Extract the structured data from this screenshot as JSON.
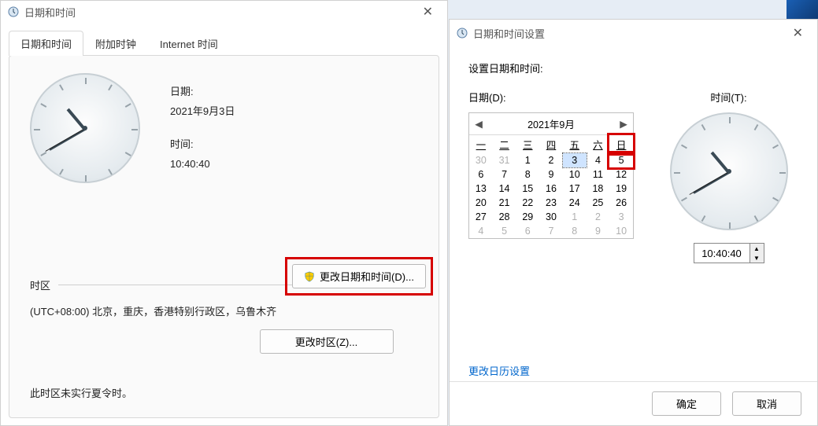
{
  "dlg1": {
    "title": "日期和时间",
    "tabs": [
      "日期和时间",
      "附加时钟",
      "Internet 时间"
    ],
    "date_label": "日期:",
    "date_value": "2021年9月3日",
    "time_label": "时间:",
    "time_value": "10:40:40",
    "change_datetime_btn": "更改日期和时间(D)...",
    "tz_heading": "时区",
    "tz_value": "(UTC+08:00) 北京，重庆，香港特别行政区，乌鲁木齐",
    "change_tz_btn": "更改时区(Z)...",
    "dst_note": "此时区未实行夏令时。"
  },
  "dlg2": {
    "title": "日期和时间设置",
    "heading": "设置日期和时间:",
    "date_label": "日期(D):",
    "time_label": "时间(T):",
    "cal": {
      "title": "2021年9月",
      "dow": [
        "一",
        "二",
        "三",
        "四",
        "五",
        "六",
        "日"
      ],
      "weeks": [
        [
          {
            "n": 30,
            "out": true
          },
          {
            "n": 31,
            "out": true
          },
          {
            "n": 1
          },
          {
            "n": 2
          },
          {
            "n": 3,
            "sel": true
          },
          {
            "n": 4
          },
          {
            "n": 5,
            "red": true
          }
        ],
        [
          {
            "n": 6
          },
          {
            "n": 7
          },
          {
            "n": 8
          },
          {
            "n": 9
          },
          {
            "n": 10
          },
          {
            "n": 11
          },
          {
            "n": 12
          }
        ],
        [
          {
            "n": 13
          },
          {
            "n": 14
          },
          {
            "n": 15
          },
          {
            "n": 16
          },
          {
            "n": 17
          },
          {
            "n": 18
          },
          {
            "n": 19
          }
        ],
        [
          {
            "n": 20
          },
          {
            "n": 21
          },
          {
            "n": 22
          },
          {
            "n": 23
          },
          {
            "n": 24
          },
          {
            "n": 25
          },
          {
            "n": 26
          }
        ],
        [
          {
            "n": 27
          },
          {
            "n": 28
          },
          {
            "n": 29
          },
          {
            "n": 30
          },
          {
            "n": 1,
            "out": true
          },
          {
            "n": 2,
            "out": true
          },
          {
            "n": 3,
            "out": true
          }
        ],
        [
          {
            "n": 4,
            "out": true
          },
          {
            "n": 5,
            "out": true
          },
          {
            "n": 6,
            "out": true
          },
          {
            "n": 7,
            "out": true
          },
          {
            "n": 8,
            "out": true
          },
          {
            "n": 9,
            "out": true
          },
          {
            "n": 10,
            "out": true
          }
        ]
      ]
    },
    "time_value": "10:40:40",
    "link": "更改日历设置",
    "ok": "确定",
    "cancel": "取消"
  }
}
